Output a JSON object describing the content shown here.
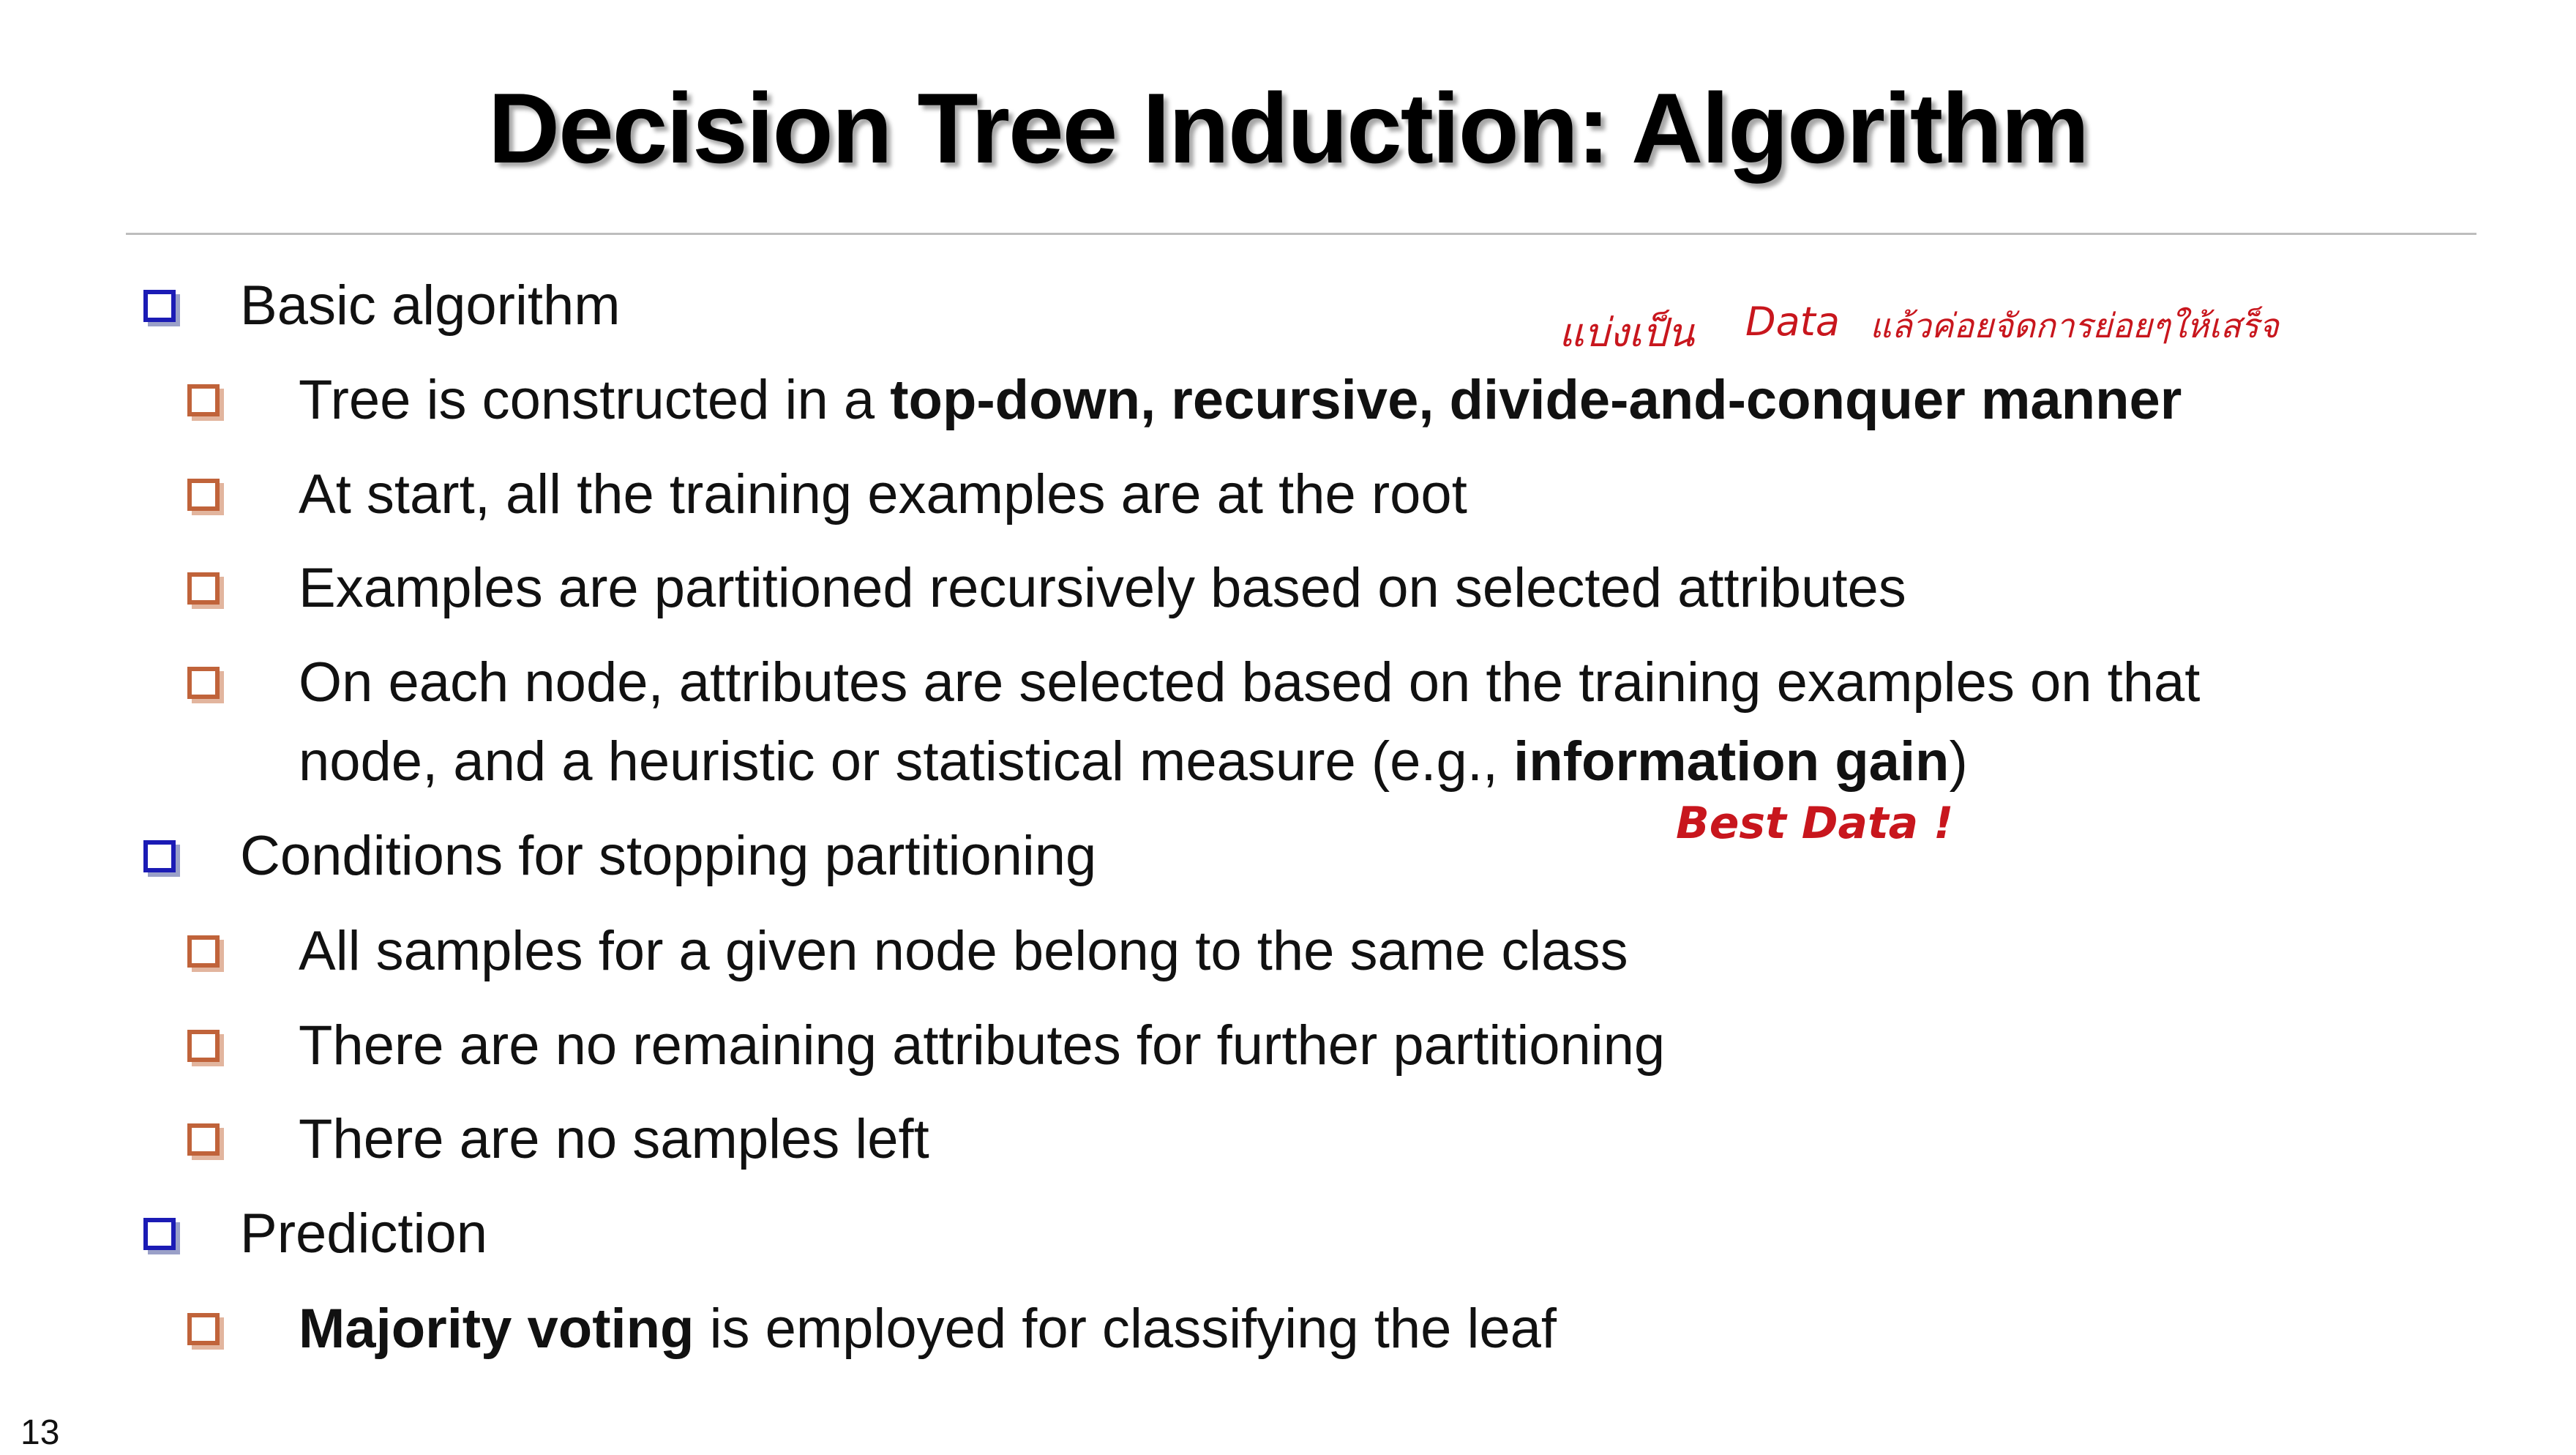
{
  "slide": {
    "title": "Decision Tree Induction: Algorithm",
    "number": "13"
  },
  "items": {
    "b1": "Basic algorithm",
    "b1_1_a": "Tree is constructed in a ",
    "b1_1_b": "top-down, recursive, divide-and-conquer manner",
    "b1_2": "At start, all the training examples are at the root",
    "b1_3": "Examples are partitioned recursively based on selected attributes",
    "b1_4_line1": "On each node, attributes are selected based on the training examples on that",
    "b1_4_line2_a": "node, and a heuristic or statistical measure (e.g., ",
    "b1_4_line2_b": "information gain",
    "b1_4_line2_c": ")",
    "b2": "Conditions for stopping partitioning",
    "b2_1": "All samples for a given node belong to the same class",
    "b2_2": "There are no remaining attributes for further partitioning",
    "b2_3": "There are no samples left",
    "b3": "Prediction",
    "b3_1_a": "Majority voting",
    "b3_1_b": " is employed for classifying the leaf"
  },
  "annotations": {
    "note1_thai_a": "แบ่งเป็น",
    "note1_data": "Data",
    "note1_thai_b": "แล้วค่อยจัดการย่อยๆให้เสร็จ",
    "note2": "Best Data !"
  },
  "colors": {
    "level1_bullet": "#1b1bb5",
    "level2_bullet": "#c0633a",
    "handwriting": "#c8161d"
  }
}
